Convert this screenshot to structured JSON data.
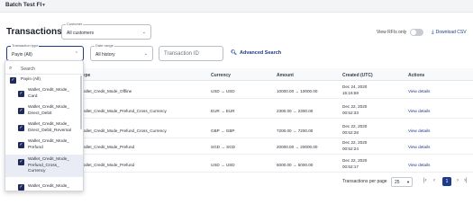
{
  "app": {
    "title": "Batch Test FI"
  },
  "page": {
    "title": "Transactions"
  },
  "filters": {
    "customer": {
      "label": "Customer",
      "value": "All customers"
    },
    "transaction_type": {
      "label": "Transaction type",
      "value": "Payin (All)"
    },
    "date_range": {
      "label": "Date range",
      "value": "All history"
    },
    "transaction_id": {
      "placeholder": "Transaction ID"
    },
    "advanced_search": "Advanced Search"
  },
  "actions": {
    "view_rfis_only": "View RFIs only",
    "download_csv": "Download CSV"
  },
  "dropdown": {
    "search_placeholder": "Search",
    "group": "Payin (All)",
    "options": [
      {
        "label_lines": [
          "Wallet_Credit_Mode_",
          "Card"
        ],
        "checked": true
      },
      {
        "label_lines": [
          "Wallet_Credit_Mode_",
          "Direct_Debit"
        ],
        "checked": true
      },
      {
        "label_lines": [
          "Wallet_Credit_Mode_",
          "Direct_Debit_Reversal"
        ],
        "checked": true
      },
      {
        "label_lines": [
          "Wallet_Credit_Mode_",
          "Prefund"
        ],
        "checked": true
      },
      {
        "label_lines": [
          "Wallet_Credit_Mode_",
          "Prefund_Cross_",
          "Currency"
        ],
        "checked": true
      },
      {
        "label_lines": [
          "Wallet_Credit_Mode_"
        ],
        "checked": true
      }
    ]
  },
  "table": {
    "columns": [
      "Type",
      "Currency",
      "Amount",
      "Created (UTC)",
      "Actions"
    ],
    "rows": [
      {
        "type": "Wallet_Credit_Mode_Offline",
        "currency": "USD → USD",
        "amount": "10000.00 → 10000.00",
        "date": "Dec 24, 2020",
        "time": "15:16:59",
        "action": "View details"
      },
      {
        "type": "Wallet_Credit_Mode_Prefund_Cross_Currency",
        "currency": "EUR → EUR",
        "amount": "2300.00 → 2300.00",
        "date": "Dec 22, 2020",
        "time": "00:52:33",
        "action": "View details"
      },
      {
        "type": "Wallet_Credit_Mode_Prefund_Cross_Currency",
        "currency": "GBP → GBP",
        "amount": "7200.00 → 7200.00",
        "date": "Dec 22, 2020",
        "time": "00:52:28",
        "action": "View details"
      },
      {
        "type": "Wallet_Credit_Mode_Prefund",
        "currency": "SGD → SGD",
        "amount": "20000.00 → 20000.00",
        "date": "Dec 22, 2020",
        "time": "00:52:24",
        "action": "View details"
      },
      {
        "type": "Wallet_Credit_Mode_Prefund",
        "currency": "USD → USD",
        "amount": "5000.00 → 5000.00",
        "date": "Dec 22, 2020",
        "time": "00:52:17",
        "action": "View details"
      }
    ]
  },
  "pagination": {
    "per_page_label": "Transactions per page",
    "per_page_value": "25",
    "current_page": "1"
  },
  "colors": {
    "accent": "#1e3a8a",
    "checkbox": "#1e2a5a"
  }
}
